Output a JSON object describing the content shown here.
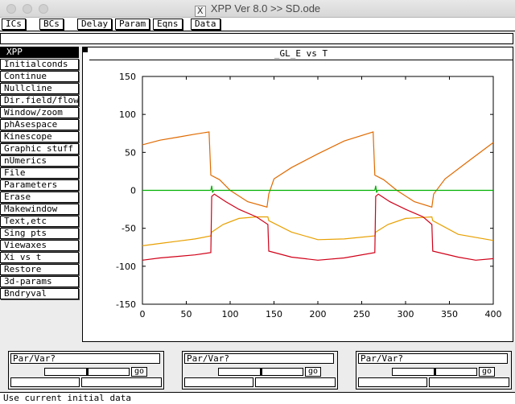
{
  "window": {
    "title": "XPP Ver 8.0 >> SD.ode"
  },
  "topmenu": {
    "items": [
      "ICs",
      "BCs",
      "Delay",
      "Param",
      "Eqns",
      "Data"
    ]
  },
  "sidemenu": {
    "title": "XPP",
    "items": [
      "Initialconds",
      "Continue",
      "Nullcline",
      "Dir.field/flow",
      "Window/zoom",
      "phAsespace",
      "Kinescope",
      "Graphic stuff",
      "nUmerics",
      "File",
      "Parameters",
      "Erase",
      "Makewindow",
      "Text,etc",
      "Sing pts",
      "Viewaxes",
      "Xi vs t",
      "Restore",
      "3d-params",
      "Bndryval"
    ]
  },
  "graph": {
    "title": "_GL_E vs T"
  },
  "sliders": [
    {
      "label": "Par/Var?",
      "go": "go",
      "knob": 0.5
    },
    {
      "label": "Par/Var?",
      "go": "go",
      "knob": 0.5
    },
    {
      "label": "Par/Var?",
      "go": "go",
      "knob": 0.5
    }
  ],
  "status": {
    "text": "Use current initial data"
  },
  "colors": {
    "orange": "#e06a00",
    "amber": "#e8a000",
    "red": "#d00018",
    "green": "#00b000"
  },
  "chart_data": {
    "type": "line",
    "title": "_GL_E vs T",
    "xlabel": "",
    "ylabel": "",
    "xlim": [
      0,
      400
    ],
    "ylim": [
      -150,
      150
    ],
    "xticks": [
      0,
      50,
      100,
      150,
      200,
      250,
      300,
      350,
      400
    ],
    "yticks": [
      150,
      100,
      50,
      0,
      -50,
      -100,
      -150
    ],
    "grid": false,
    "series": [
      {
        "color": "#e06a00",
        "points": [
          [
            0,
            60
          ],
          [
            20,
            66
          ],
          [
            40,
            70
          ],
          [
            60,
            74
          ],
          [
            76,
            77
          ],
          [
            78,
            20
          ],
          [
            88,
            14
          ],
          [
            100,
            0
          ],
          [
            120,
            -15
          ],
          [
            142,
            -22
          ],
          [
            144,
            -5
          ],
          [
            150,
            15
          ],
          [
            170,
            30
          ],
          [
            200,
            48
          ],
          [
            230,
            65
          ],
          [
            263,
            77
          ],
          [
            265,
            20
          ],
          [
            275,
            14
          ],
          [
            290,
            0
          ],
          [
            310,
            -15
          ],
          [
            330,
            -22
          ],
          [
            332,
            -5
          ],
          [
            345,
            15
          ],
          [
            370,
            37
          ],
          [
            400,
            63
          ]
        ]
      },
      {
        "color": "#e8a000",
        "points": [
          [
            0,
            -73
          ],
          [
            20,
            -70
          ],
          [
            40,
            -67
          ],
          [
            60,
            -64
          ],
          [
            78,
            -60
          ],
          [
            79,
            -55
          ],
          [
            92,
            -45
          ],
          [
            110,
            -37
          ],
          [
            130,
            -35
          ],
          [
            143,
            -35
          ],
          [
            144,
            -40
          ],
          [
            170,
            -55
          ],
          [
            200,
            -65
          ],
          [
            230,
            -64
          ],
          [
            265,
            -60
          ],
          [
            266,
            -55
          ],
          [
            280,
            -45
          ],
          [
            300,
            -37
          ],
          [
            330,
            -35
          ],
          [
            331,
            -40
          ],
          [
            360,
            -58
          ],
          [
            400,
            -66
          ]
        ]
      },
      {
        "color": "#d00018",
        "points": [
          [
            0,
            -92
          ],
          [
            20,
            -89
          ],
          [
            40,
            -87
          ],
          [
            60,
            -85
          ],
          [
            78,
            -82
          ],
          [
            79,
            -8
          ],
          [
            82,
            -5
          ],
          [
            95,
            -15
          ],
          [
            110,
            -25
          ],
          [
            130,
            -35
          ],
          [
            143,
            -45
          ],
          [
            144,
            -80
          ],
          [
            170,
            -88
          ],
          [
            200,
            -92
          ],
          [
            230,
            -89
          ],
          [
            265,
            -82
          ],
          [
            266,
            -8
          ],
          [
            269,
            -5
          ],
          [
            282,
            -15
          ],
          [
            300,
            -25
          ],
          [
            320,
            -35
          ],
          [
            330,
            -45
          ],
          [
            331,
            -80
          ],
          [
            360,
            -88
          ],
          [
            380,
            -92
          ],
          [
            400,
            -90
          ]
        ]
      },
      {
        "color": "#00b000",
        "points": [
          [
            0,
            0
          ],
          [
            78,
            0
          ],
          [
            79,
            6
          ],
          [
            80,
            -3
          ],
          [
            81,
            0
          ],
          [
            265,
            0
          ],
          [
            266,
            6
          ],
          [
            267,
            -3
          ],
          [
            268,
            0
          ],
          [
            400,
            0
          ]
        ]
      }
    ]
  }
}
